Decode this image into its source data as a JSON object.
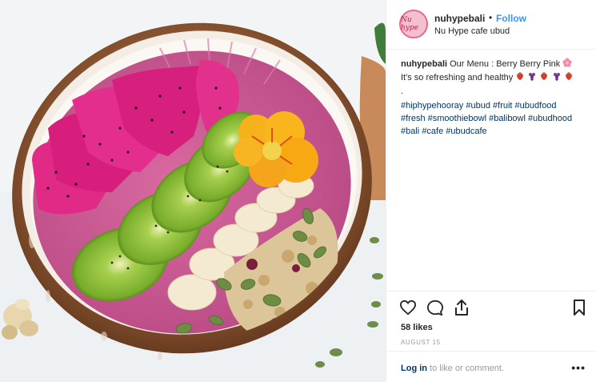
{
  "post": {
    "username": "nuhypebali",
    "separator": "•",
    "follow_label": "Follow",
    "location": "Nu Hype cafe ubud",
    "avatar_text": "Nu hype",
    "photo_alt": "Berry Berry Pink smoothie bowl"
  },
  "caption": {
    "username": "nuhypebali",
    "text_line1": "Our Menu : Berry Berry Pink",
    "text_line2": "It's so refreshing and healthy",
    "line3": ".",
    "hashtags": [
      "#hiphypehooray",
      "#ubud",
      "#fruit",
      "#ubudfood",
      "#fresh",
      "#smoothiebowl",
      "#balibowl",
      "#ubudhood",
      "#bali",
      "#cafe",
      "#ubudcafe"
    ],
    "emoji_flower": "flower-emoji",
    "emoji_fruits": [
      "strawberry-emoji",
      "grapes-emoji",
      "strawberry-emoji",
      "grapes-emoji",
      "strawberry-emoji"
    ]
  },
  "engagement": {
    "likes": "58 likes",
    "date": "AUGUST 15",
    "login_link": "Log in",
    "login_rest": " to like or comment.",
    "more": "•••"
  },
  "colors": {
    "link": "#3897f0",
    "hashtag": "#003569",
    "muted": "#999999",
    "text": "#262626"
  }
}
